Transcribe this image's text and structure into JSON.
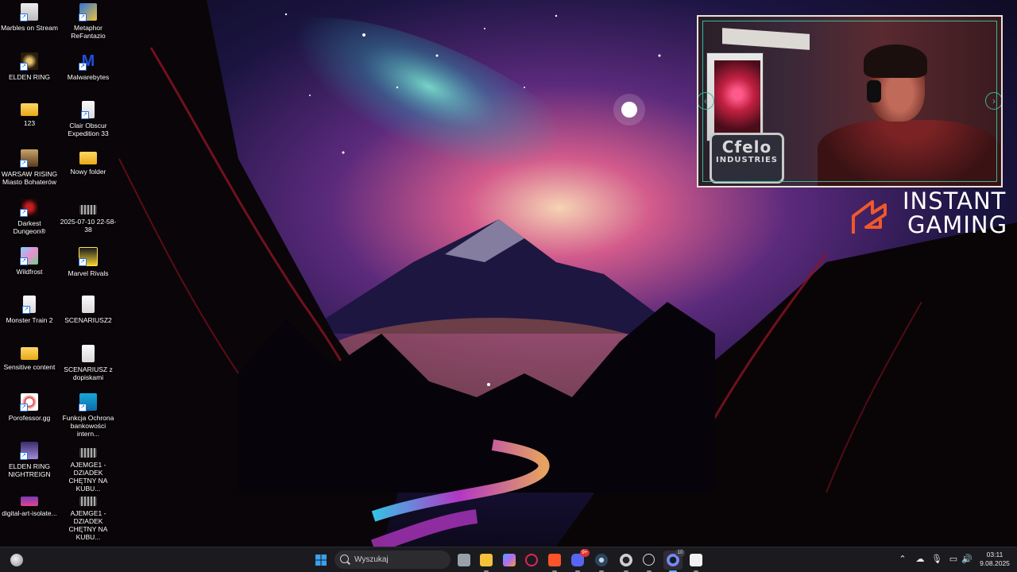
{
  "desktop": {
    "column1": [
      {
        "label": "Marbles on Stream",
        "icon": "marbles-game-icon",
        "style": "g-marbles"
      },
      {
        "label": "ELDEN RING",
        "icon": "elden-ring-icon",
        "style": "g-game-ring"
      },
      {
        "label": "123",
        "icon": "folder-icon",
        "style": "g-folder"
      },
      {
        "label": "WARSAW RISING Miasto Bohaterów",
        "icon": "warsaw-rising-icon",
        "style": "g-warsaw"
      },
      {
        "label": "Darkest Dungeon®",
        "icon": "darkest-dungeon-icon",
        "style": "g-darkest"
      },
      {
        "label": "Wildfrost",
        "icon": "wildfrost-icon",
        "style": "g-wildfrost"
      },
      {
        "label": "Monster Train 2",
        "icon": "file-icon",
        "style": "g-file"
      },
      {
        "label": "Sensitive content",
        "icon": "folder-icon",
        "style": "g-folder"
      },
      {
        "label": "Porofessor.gg",
        "icon": "porofessor-icon",
        "style": "g-porof"
      },
      {
        "label": "ELDEN RING NIGHTREIGN",
        "icon": "nightreign-icon",
        "style": "g-nightreign"
      },
      {
        "label": "digital-art-isolate...",
        "icon": "image-file-icon",
        "style": "g-digital"
      }
    ],
    "column2": [
      {
        "label": "Metaphor ReFantazio",
        "icon": "metaphor-icon",
        "style": "g-meta"
      },
      {
        "label": "Malwarebytes",
        "icon": "malwarebytes-icon",
        "style": "g-malware"
      },
      {
        "label": "Clair Obscur Expedition 33",
        "icon": "file-icon",
        "style": "g-file"
      },
      {
        "label": "Nowy folder",
        "icon": "folder-icon",
        "style": "g-folder"
      },
      {
        "label": "2025-07-10 22-58-38",
        "icon": "video-file-icon",
        "style": "g-video"
      },
      {
        "label": "Marvel Rivals",
        "icon": "marvel-rivals-icon",
        "style": "g-marvel"
      },
      {
        "label": "SCENARIUSZ2",
        "icon": "document-icon",
        "style": "g-file"
      },
      {
        "label": "SCENARIUSZ z dopiskami",
        "icon": "document-icon",
        "style": "g-file"
      },
      {
        "label": "Funkcja Ochrona bankowości intern...",
        "icon": "bank-protection-icon",
        "style": "g-bank"
      },
      {
        "label": "AJEMGE1 - DZIADEK CHĘTNY NA KUBU...",
        "icon": "video-file-icon",
        "style": "g-video"
      },
      {
        "label": "AJEMGE1 - DZIADEK CHĘTNY NA KUBU...",
        "icon": "video-file-icon",
        "style": "g-video"
      }
    ]
  },
  "overlay": {
    "webcam_badge_line1": "Cfelo",
    "webcam_badge_line2": "INDUSTRIES",
    "sponsor_line1": "INSTANT",
    "sponsor_line2": "GAMING",
    "sponsor_color": "#f0582a"
  },
  "taskbar": {
    "search_placeholder": "Wyszukaj",
    "apps": [
      {
        "name": "task-view-icon",
        "color": "#9aa0a8"
      },
      {
        "name": "file-explorer-icon",
        "color": "#f3c13a"
      },
      {
        "name": "copilot-icon",
        "color": "#7b6cf0"
      },
      {
        "name": "opera-gx-icon",
        "color": "#e0245e"
      },
      {
        "name": "brave-icon",
        "color": "#fb542b"
      },
      {
        "name": "discord-icon",
        "color": "#5865f2",
        "badge": "9+"
      },
      {
        "name": "steam-icon",
        "color": "#4c7fbd"
      },
      {
        "name": "obs-icon",
        "color": "#cfcfcf"
      },
      {
        "name": "media-player-icon",
        "color": "#dcdcdc"
      },
      {
        "name": "browser-icon",
        "color": "#4aa3ff",
        "badge": "10"
      },
      {
        "name": "capcut-icon",
        "color": "#f2f2f2"
      }
    ],
    "clock_time": "03:11",
    "clock_date": "9.08.2025"
  }
}
